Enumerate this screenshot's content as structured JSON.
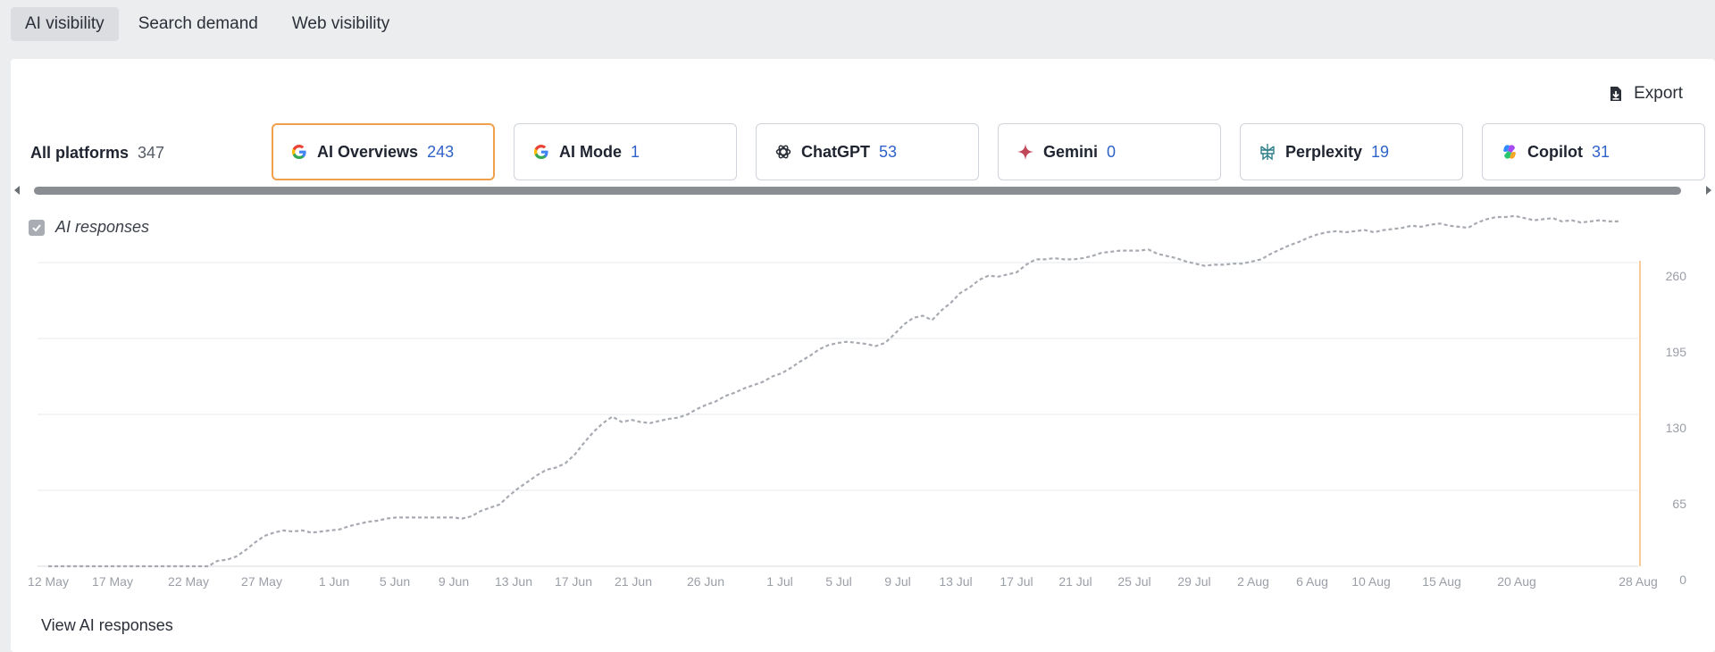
{
  "tabs": [
    {
      "label": "AI visibility",
      "active": true
    },
    {
      "label": "Search demand",
      "active": false
    },
    {
      "label": "Web visibility",
      "active": false
    }
  ],
  "export_label": "Export",
  "platforms": {
    "all": {
      "label": "All platforms",
      "count": "347"
    },
    "cards": [
      {
        "label": "AI Overviews",
        "count": "243",
        "icon": "google-icon",
        "active": true
      },
      {
        "label": "AI Mode",
        "count": "1",
        "icon": "google-icon",
        "active": false
      },
      {
        "label": "ChatGPT",
        "count": "53",
        "icon": "chatgpt-icon",
        "active": false
      },
      {
        "label": "Gemini",
        "count": "0",
        "icon": "gemini-icon",
        "active": false
      },
      {
        "label": "Perplexity",
        "count": "19",
        "icon": "perplexity-icon",
        "active": false
      },
      {
        "label": "Copilot",
        "count": "31",
        "icon": "copilot-icon",
        "active": false
      }
    ]
  },
  "legend": {
    "label": "AI responses",
    "checked": true
  },
  "view_link": "View AI responses",
  "colors": {
    "accent": "#f0a04b",
    "count_blue": "#2f62c9",
    "line": "#a7abb1",
    "grid": "#e6e8eb"
  },
  "chart_data": {
    "type": "line",
    "series": [
      {
        "values": [
          0,
          0,
          0,
          0,
          0,
          0,
          0,
          0,
          0,
          0,
          0,
          0,
          0,
          0,
          0,
          0,
          0,
          0,
          5,
          6,
          9,
          15,
          22,
          28,
          31,
          33,
          32,
          33,
          31,
          32,
          33,
          34,
          37,
          39,
          41,
          42,
          44,
          45,
          45,
          45,
          45,
          45,
          45,
          45,
          44,
          46,
          51,
          54,
          57,
          65,
          72,
          78,
          84,
          89,
          91,
          95,
          103,
          114,
          124,
          132,
          138,
          133,
          135,
          133,
          132,
          134,
          136,
          137,
          140,
          145,
          149,
          152,
          157,
          160,
          164,
          167,
          170,
          175,
          178,
          183,
          189,
          194,
          200,
          204,
          206,
          207,
          206,
          205,
          203,
          206,
          214,
          223,
          229,
          231,
          227,
          236,
          243,
          252,
          257,
          264,
          268,
          267,
          269,
          271,
          278,
          283,
          283,
          284,
          283,
          283,
          284,
          286,
          289,
          290,
          291,
          291,
          291,
          292,
          288,
          286,
          284,
          281,
          279,
          277,
          278,
          278,
          279,
          279,
          281,
          283,
          288,
          292,
          296,
          299,
          303,
          306,
          308,
          309,
          308,
          309,
          310,
          308,
          310,
          311,
          312,
          314,
          313,
          315,
          316,
          314,
          313,
          312,
          317,
          320,
          322,
          322,
          323,
          321,
          319,
          320,
          321,
          318,
          319,
          317,
          318,
          319,
          318,
          318
        ]
      }
    ],
    "x_ticks": [
      "12 May",
      "17 May",
      "22 May",
      "27 May",
      "1 Jun",
      "5 Jun",
      "9 Jun",
      "13 Jun",
      "17 Jun",
      "21 Jun",
      "26 Jun",
      "1 Jul",
      "5 Jul",
      "9 Jul",
      "13 Jul",
      "17 Jul",
      "21 Jul",
      "25 Jul",
      "29 Jul",
      "2 Aug",
      "6 Aug",
      "10 Aug",
      "15 Aug",
      "20 Aug",
      "28 Aug"
    ],
    "y_ticks": [
      "0",
      "65",
      "130",
      "195",
      "260"
    ],
    "ylim": [
      0,
      260
    ],
    "grid": true
  }
}
